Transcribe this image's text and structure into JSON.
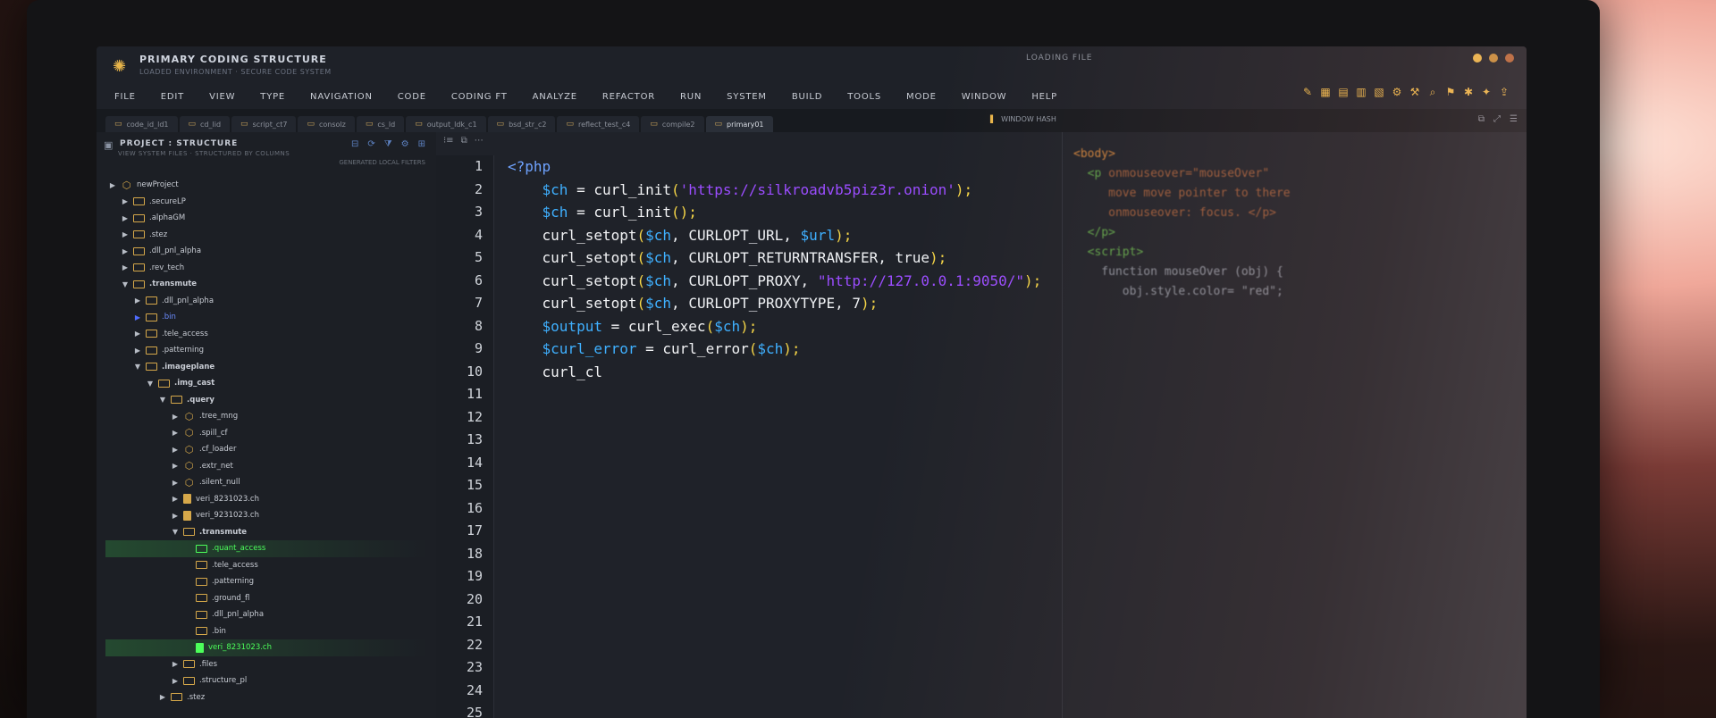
{
  "window": {
    "title": "PRIMARY CODING STRUCTURE",
    "subtitle": "LOADED ENVIRONMENT · SECURE CODE SYSTEM",
    "status": "LOADING FILE"
  },
  "menu": [
    "FILE",
    "EDIT",
    "VIEW",
    "TYPE",
    "NAVIGATION",
    "CODE",
    "CODING FT",
    "ANALYZE",
    "REFACTOR",
    "RUN",
    "SYSTEM",
    "BUILD",
    "TOOLS",
    "MODE",
    "WINDOW",
    "HELP"
  ],
  "tabs": [
    "code_id_ld1",
    "cd_lid",
    "script_ct7",
    "consolz",
    "cs_ld",
    "output_ldk_c1",
    "bsd_str_c2",
    "reflect_test_c4",
    "compile2",
    "primary01"
  ],
  "right_label": "WINDOW HASH",
  "panel": {
    "title": "PROJECT : STRUCTURE",
    "subtitle": "VIEW SYSTEM FILES · STRUCTURED BY COLUMNS",
    "filter": "GENERATED LOCAL FILTERS"
  },
  "tree": [
    {
      "label": "newProject",
      "depth": 0,
      "arrow": "▶",
      "icon": "cube"
    },
    {
      "label": ".secureLP",
      "depth": 1,
      "arrow": "▶",
      "icon": "folder"
    },
    {
      "label": ".alphaGM",
      "depth": 1,
      "arrow": "▶",
      "icon": "folder"
    },
    {
      "label": ".stez",
      "depth": 1,
      "arrow": "▶",
      "icon": "folder"
    },
    {
      "label": ".dll_pnl_alpha",
      "depth": 1,
      "arrow": "▶",
      "icon": "folder"
    },
    {
      "label": ".rev_tech",
      "depth": 1,
      "arrow": "▶",
      "icon": "folder"
    },
    {
      "label": ".transmute",
      "depth": 1,
      "arrow": "▼",
      "icon": "folder",
      "bold": true
    },
    {
      "label": ".dll_pnl_alpha",
      "depth": 2,
      "arrow": "▶",
      "icon": "folder"
    },
    {
      "label": ".bin",
      "depth": 2,
      "arrow": "▶",
      "icon": "folder",
      "state": "sel"
    },
    {
      "label": ".tele_access",
      "depth": 2,
      "arrow": "▶",
      "icon": "folder"
    },
    {
      "label": ".patterning",
      "depth": 2,
      "arrow": "▶",
      "icon": "folder"
    },
    {
      "label": ".imageplane",
      "depth": 2,
      "arrow": "▼",
      "icon": "folder",
      "bold": true
    },
    {
      "label": ".img_cast",
      "depth": 3,
      "arrow": "▼",
      "icon": "folder",
      "bold": true
    },
    {
      "label": ".query",
      "depth": 4,
      "arrow": "▼",
      "icon": "folder",
      "bold": true
    },
    {
      "label": ".tree_mng",
      "depth": 5,
      "arrow": "▶",
      "icon": "cube"
    },
    {
      "label": ".spill_cf",
      "depth": 5,
      "arrow": "▶",
      "icon": "cube"
    },
    {
      "label": ".cf_loader",
      "depth": 5,
      "arrow": "▶",
      "icon": "cube"
    },
    {
      "label": ".extr_net",
      "depth": 5,
      "arrow": "▶",
      "icon": "cube"
    },
    {
      "label": ".silent_null",
      "depth": 5,
      "arrow": "▶",
      "icon": "cube"
    },
    {
      "label": "veri_8231023.ch",
      "depth": 5,
      "arrow": "▶",
      "icon": "file"
    },
    {
      "label": "veri_9231023.ch",
      "depth": 5,
      "arrow": "▶",
      "icon": "file"
    },
    {
      "label": ".transmute",
      "depth": 5,
      "arrow": "▼",
      "icon": "folder",
      "bold": true
    },
    {
      "label": ".quant_access",
      "depth": 6,
      "arrow": "",
      "icon": "folder",
      "state": "hl"
    },
    {
      "label": ".tele_access",
      "depth": 6,
      "arrow": "",
      "icon": "folder"
    },
    {
      "label": ".patterning",
      "depth": 6,
      "arrow": "",
      "icon": "folder"
    },
    {
      "label": ".ground_fl",
      "depth": 6,
      "arrow": "",
      "icon": "folder"
    },
    {
      "label": ".dll_pnl_alpha",
      "depth": 6,
      "arrow": "",
      "icon": "folder"
    },
    {
      "label": ".bin",
      "depth": 6,
      "arrow": "",
      "icon": "folder"
    },
    {
      "label": "veri_8231023.ch",
      "depth": 6,
      "arrow": "",
      "icon": "file",
      "state": "hl"
    },
    {
      "label": ".files",
      "depth": 5,
      "arrow": "▶",
      "icon": "folder"
    },
    {
      "label": ".structure_pl",
      "depth": 5,
      "arrow": "▶",
      "icon": "folder"
    },
    {
      "label": ".stez",
      "depth": 4,
      "arrow": "▶",
      "icon": "folder"
    }
  ],
  "line_numbers": [
    "1",
    "2",
    "3",
    "4",
    "5",
    "6",
    "7",
    "8",
    "9",
    "10",
    "11",
    "12",
    "13",
    "14",
    "15",
    "16",
    "17",
    "18",
    "19",
    "20",
    "21",
    "22",
    "23",
    "24",
    "25"
  ],
  "code": [
    [
      {
        "t": "<?php",
        "c": "kw"
      }
    ],
    [
      {
        "t": "    $ch",
        "c": "var"
      },
      {
        "t": " = curl_init",
        "c": "fn"
      },
      {
        "t": "(",
        "c": "paren"
      },
      {
        "t": "'https://silkroadvb5piz3r.onion'",
        "c": "str"
      },
      {
        "t": ");",
        "c": "paren"
      }
    ],
    [
      {
        "t": "    $ch",
        "c": "var"
      },
      {
        "t": " = curl_init",
        "c": "fn"
      },
      {
        "t": "();",
        "c": "paren"
      }
    ],
    [
      {
        "t": "    curl_setopt",
        "c": "fn"
      },
      {
        "t": "(",
        "c": "paren"
      },
      {
        "t": "$ch",
        "c": "var"
      },
      {
        "t": ", CURLOPT_URL, ",
        "c": "const"
      },
      {
        "t": "$url",
        "c": "var"
      },
      {
        "t": ");",
        "c": "paren"
      }
    ],
    [
      {
        "t": "    curl_setopt",
        "c": "fn"
      },
      {
        "t": "(",
        "c": "paren"
      },
      {
        "t": "$ch",
        "c": "var"
      },
      {
        "t": ", CURLOPT_RETURNTRANSFER, true",
        "c": "const"
      },
      {
        "t": ");",
        "c": "paren"
      }
    ],
    [
      {
        "t": "    curl_setopt",
        "c": "fn"
      },
      {
        "t": "(",
        "c": "paren"
      },
      {
        "t": "$ch",
        "c": "var"
      },
      {
        "t": ", CURLOPT_PROXY, ",
        "c": "const"
      },
      {
        "t": "\"http://127.0.0.1:9050/\"",
        "c": "str"
      },
      {
        "t": ");",
        "c": "paren"
      }
    ],
    [
      {
        "t": "    curl_setopt",
        "c": "fn"
      },
      {
        "t": "(",
        "c": "paren"
      },
      {
        "t": "$ch",
        "c": "var"
      },
      {
        "t": ", CURLOPT_PROXYTYPE, 7",
        "c": "const"
      },
      {
        "t": ");",
        "c": "paren"
      }
    ],
    [
      {
        "t": "    $output",
        "c": "var"
      },
      {
        "t": " = curl_exec",
        "c": "fn"
      },
      {
        "t": "(",
        "c": "paren"
      },
      {
        "t": "$ch",
        "c": "var"
      },
      {
        "t": ");",
        "c": "paren"
      }
    ],
    [
      {
        "t": "    $curl_error",
        "c": "var"
      },
      {
        "t": " = curl_error",
        "c": "fn"
      },
      {
        "t": "(",
        "c": "paren"
      },
      {
        "t": "$ch",
        "c": "var"
      },
      {
        "t": ");",
        "c": "paren"
      }
    ],
    [
      {
        "t": "    curl_cl",
        "c": "fn"
      }
    ],
    [],
    [],
    [],
    [],
    [],
    [],
    [],
    [],
    [],
    [],
    [],
    [],
    [],
    [],
    []
  ],
  "preview": [
    [
      {
        "t": "<body>",
        "c": "tag"
      }
    ],
    [
      {
        "t": "  <p ",
        "c": "tag-green"
      },
      {
        "t": "onmouseover=\"mouseOver\"",
        "c": "attr"
      }
    ],
    [
      {
        "t": "     move move pointer to there",
        "c": "attr"
      }
    ],
    [
      {
        "t": "     onmouseover: focus. </p>",
        "c": "attr"
      }
    ],
    [
      {
        "t": "  </p>",
        "c": "tag-green"
      }
    ],
    [
      {
        "t": "  <script>",
        "c": "tag-green"
      }
    ],
    [
      {
        "t": "    function mouseOver (obj) {",
        "c": "fn-dim"
      }
    ],
    [
      {
        "t": "       obj.style.color= \"red\";",
        "c": "fn-dim"
      }
    ]
  ]
}
